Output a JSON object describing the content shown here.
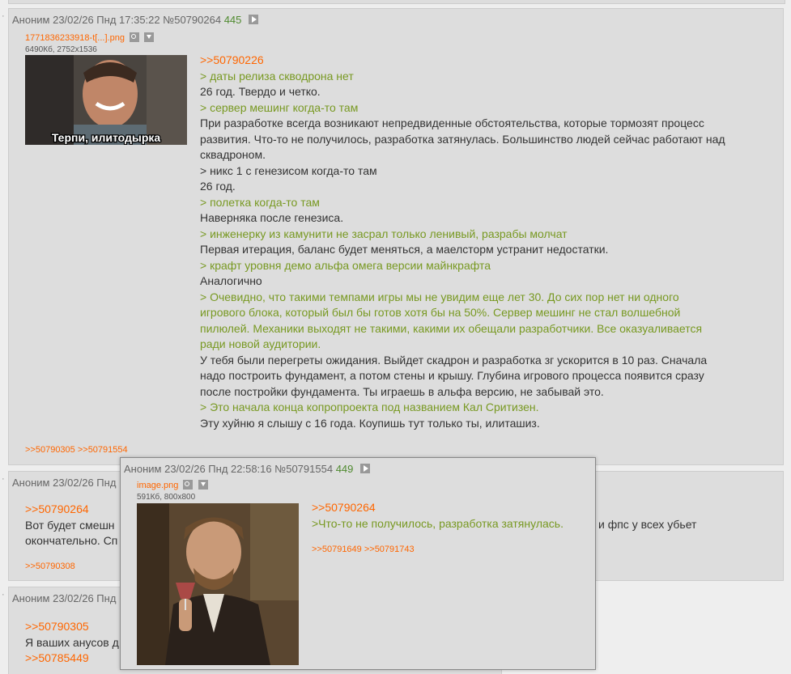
{
  "post1": {
    "name": "Аноним",
    "date": "23/02/26 Пнд 17:35:22",
    "num": "№50790264",
    "count": "445",
    "file_name": "1771836233918-t[...].png",
    "file_meta": "6490Кб, 2752x1536",
    "image_caption": "Терпи, илитодырка",
    "lines": [
      {
        "t": "link",
        "s": ">>50790226"
      },
      {
        "t": "q",
        "s": "> даты релиза скводрона нет"
      },
      {
        "t": "p",
        "s": "26 год. Твердо и четко."
      },
      {
        "t": "q",
        "s": "> сервер мешинг когда-то там"
      },
      {
        "t": "p",
        "s": "При разработке всегда возникают непредвиденные обстоятельства, которые тормозят процесс\nразвития. Что-то не получилось, разработка затянулась. Большинство людей сейчас работают над\nсквадроном."
      },
      {
        "t": "p",
        "s": "> никс 1 с генезисом когда-то там"
      },
      {
        "t": "p",
        "s": "26 год."
      },
      {
        "t": "q",
        "s": "> полетка когда-то там"
      },
      {
        "t": "p",
        "s": "Наверняка после генезиса."
      },
      {
        "t": "q",
        "s": "> инженерку из камунити не засрал только ленивый, разрабы молчат"
      },
      {
        "t": "p",
        "s": "Первая итерация, баланс будет меняться, а маелсторм устранит недостатки."
      },
      {
        "t": "q",
        "s": "> крафт уровня демо альфа омега версии майнкрафта"
      },
      {
        "t": "p",
        "s": "Аналогично"
      },
      {
        "t": "q",
        "s": "> Очевидно, что такими темпами игры мы не увидим еще лет 30. До сих пор нет ни одного\nигрового блока, который был бы готов хотя бы на 50%. Сервер мешинг не стал волшебной\nпилюлей. Механики выходят не такими, какими их обещали разработчики. Все оказуаливается\nради новой аудитории."
      },
      {
        "t": "p",
        "s": "У тебя были перегреты ожидания. Выйдет скадрон и разработка зг ускорится в 10 раз. Сначала\nнадо построить фундамент, а потом стены и крышу. Глубина игрового процесса появится сразу\nпосле постройки фундамента. Ты играешь в альфа версию, не забывай это."
      },
      {
        "t": "q",
        "s": "> Это начала конца копропроекта под названием Кал Сритизен."
      },
      {
        "t": "p",
        "s": "Эту хуйню я слышу с 16 года. Коупишь тут только ты, илиташиз."
      }
    ],
    "replies": ">>50790305 >>50791554"
  },
  "post2": {
    "name": "Аноним",
    "date": "23/02/26 Пнд",
    "link": ">>50790264",
    "line1_left": "Вот будет смешн",
    "line1_right": "и фпс у всех убьет",
    "line2_left": "окончательно. Сп",
    "replies": ">>50790308"
  },
  "post3": {
    "name": "Аноним",
    "date": "23/02/26 Пнд",
    "link1": ">>50790305",
    "line1": "Я ваших анусов д",
    "link2": ">>50785449"
  },
  "popup": {
    "name": "Аноним",
    "date": "23/02/26 Пнд 22:58:16",
    "num": "№50791554",
    "count": "449",
    "file_name": "image.png",
    "file_meta": "591Кб, 800x800",
    "link": ">>50790264",
    "quote": ">Что-то не получилось, разработка затянулась.",
    "replies": ">>50791649 >>50791743"
  },
  "colors": {
    "background": "#eeeeee",
    "post_bg": "#dddddd",
    "link": "#ff6600",
    "quote": "#789922",
    "post_count": "#4f8a2f"
  },
  "icons": [
    "play-icon",
    "search-icon",
    "download-icon"
  ]
}
